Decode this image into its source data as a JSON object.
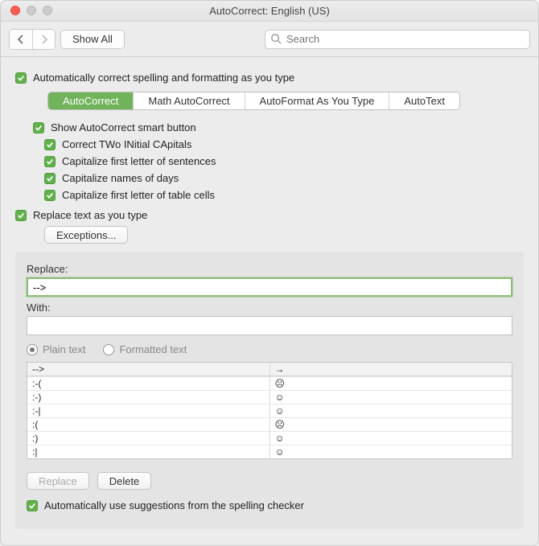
{
  "window": {
    "title": "AutoCorrect: English (US)"
  },
  "toolbar": {
    "show_all": "Show All",
    "search_placeholder": "Search"
  },
  "top_check": "Automatically correct spelling and formatting as you type",
  "tabs": {
    "items": [
      "AutoCorrect",
      "Math AutoCorrect",
      "AutoFormat As You Type",
      "AutoText"
    ],
    "active_index": 0
  },
  "options": {
    "smart_button": "Show AutoCorrect smart button",
    "two_caps": "Correct TWo INitial CApitals",
    "first_sentence": "Capitalize first letter of sentences",
    "days": "Capitalize names of days",
    "table_cells": "Capitalize first letter of table cells"
  },
  "replace_check": "Replace text as you type",
  "exceptions_btn": "Exceptions...",
  "panel": {
    "replace_label": "Replace:",
    "replace_value": "-->",
    "with_label": "With:",
    "with_value": "",
    "radio_plain": "Plain text",
    "radio_formatted": "Formatted text",
    "rows": [
      {
        "from": "-->",
        "to": "→"
      },
      {
        "from": ":-(",
        "to": "☹"
      },
      {
        "from": ":-)",
        "to": "☺"
      },
      {
        "from": ":-|",
        "to": "☺"
      },
      {
        "from": ":(",
        "to": "☹"
      },
      {
        "from": ":)",
        "to": "☺"
      },
      {
        "from": ":|",
        "to": "☺"
      }
    ],
    "replace_btn": "Replace",
    "delete_btn": "Delete",
    "spellcheck": "Automatically use suggestions from the spelling checker"
  }
}
